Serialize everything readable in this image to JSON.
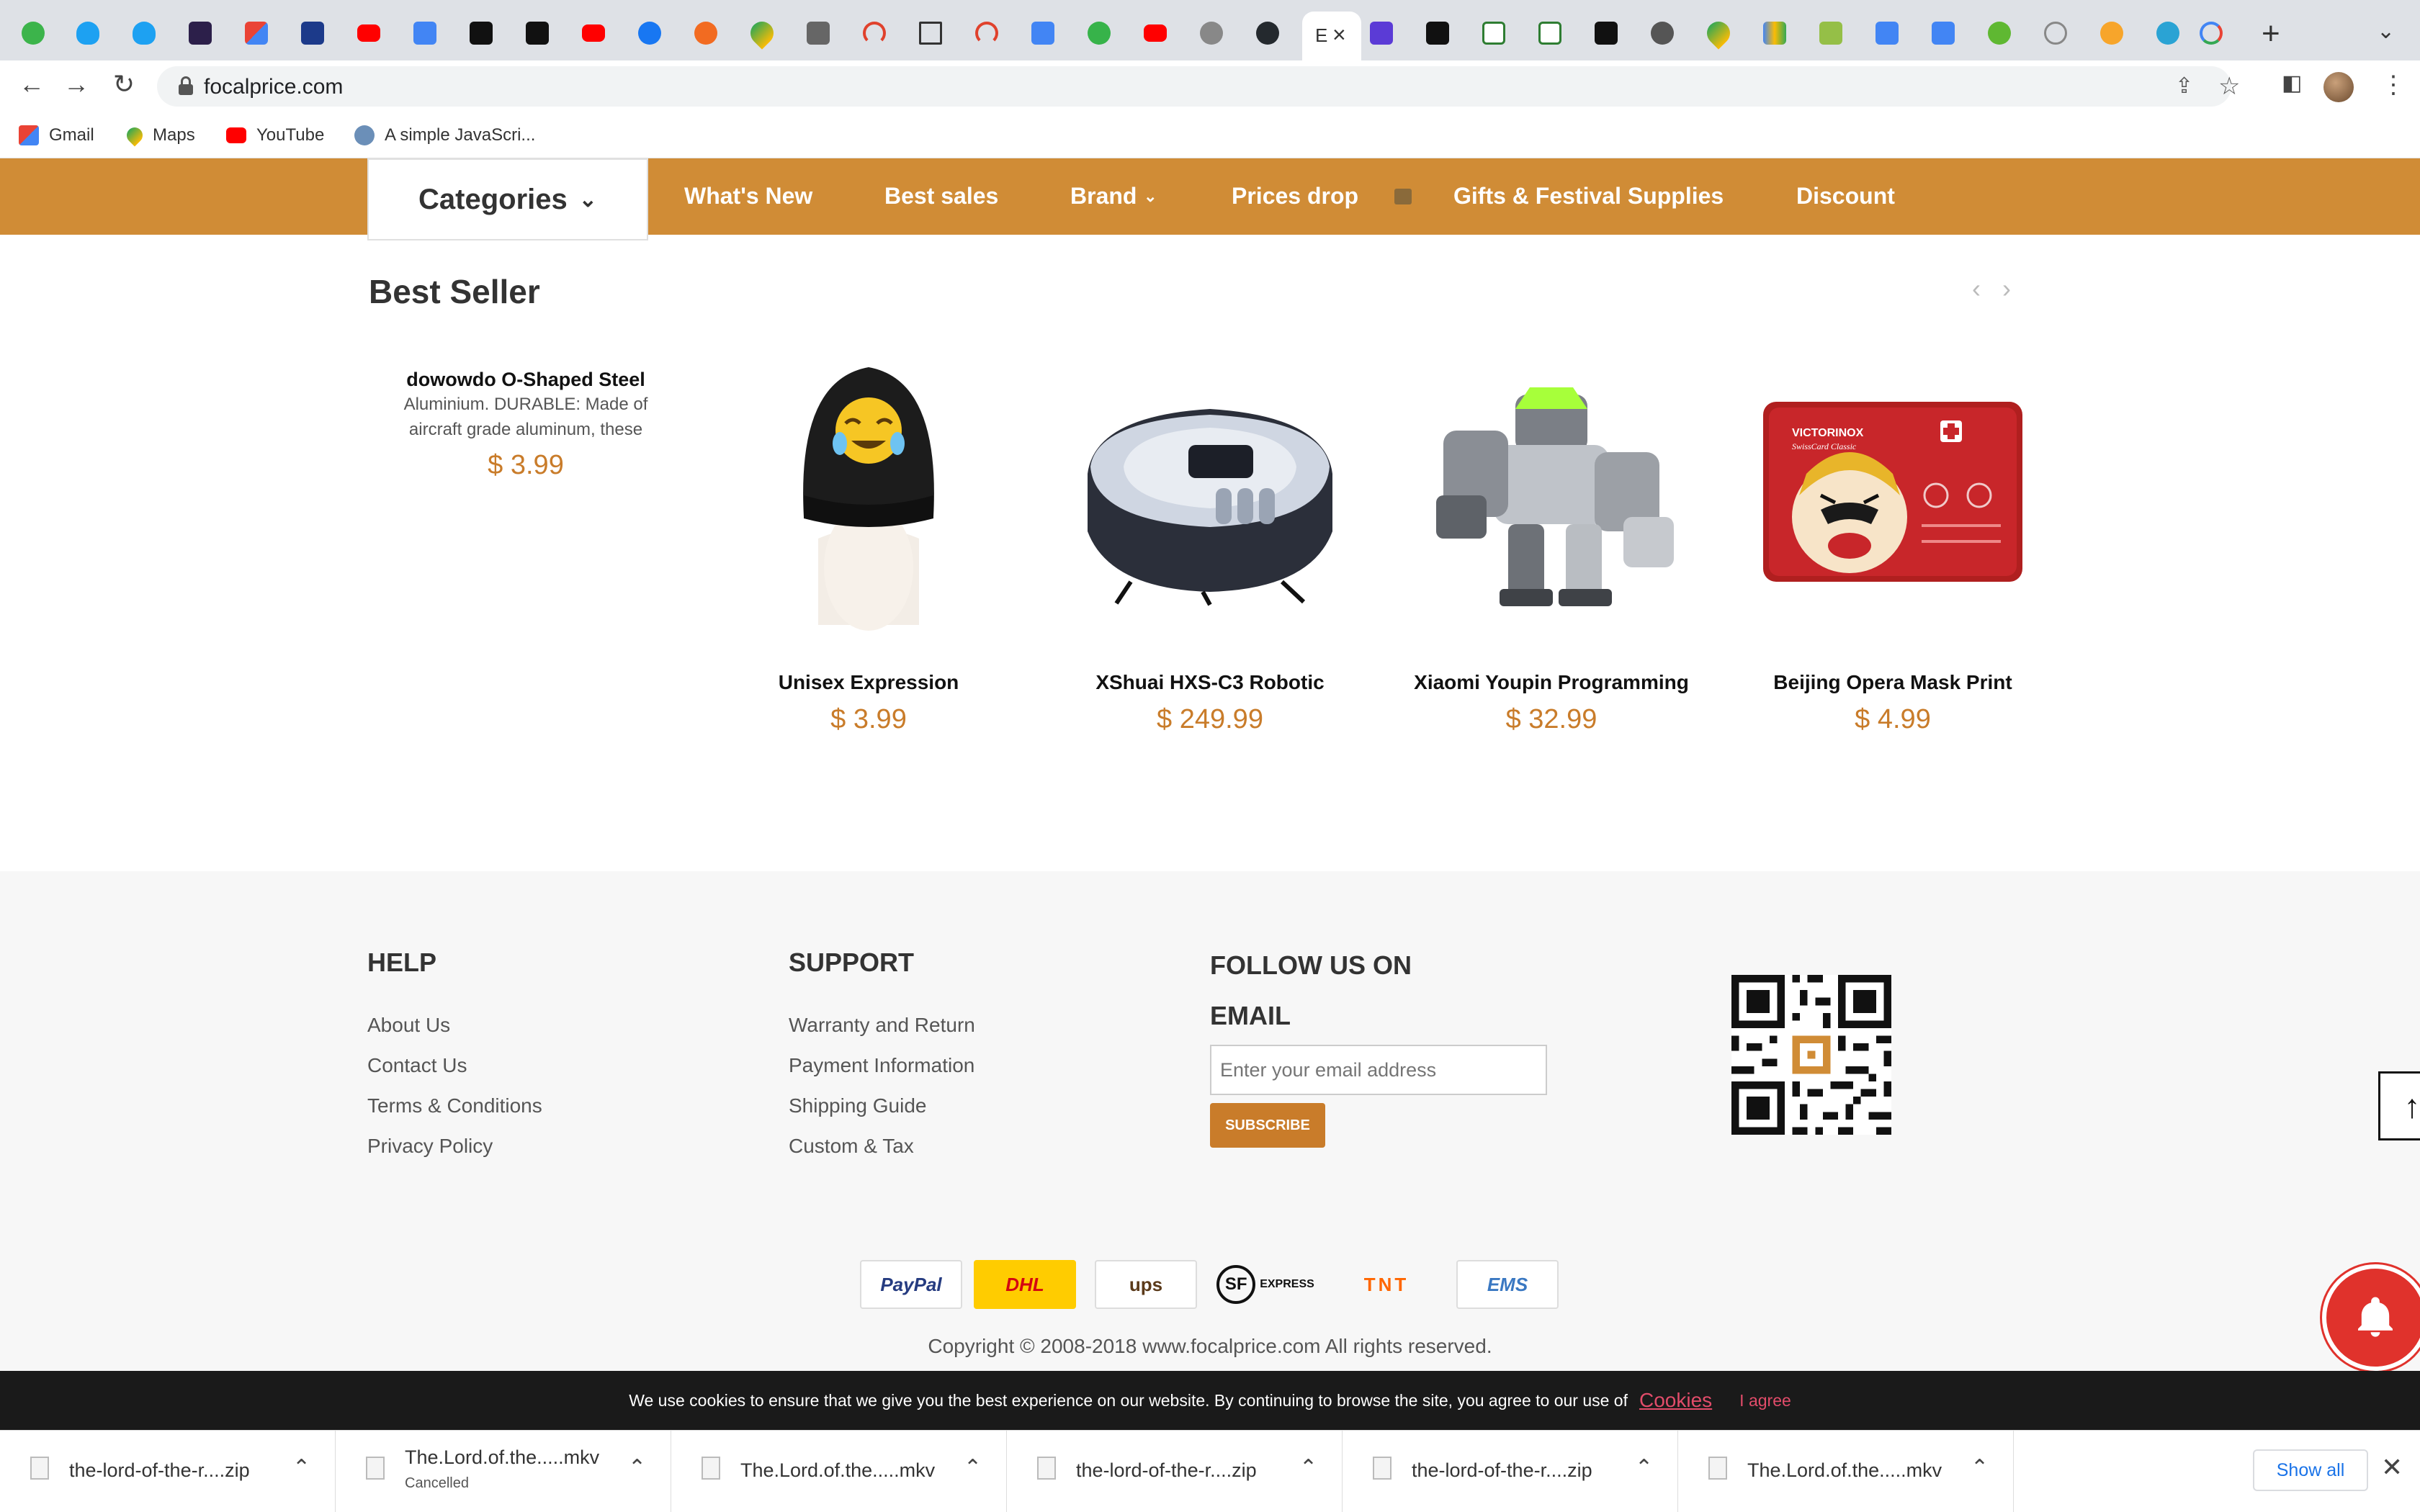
{
  "browser": {
    "active_tab_letter": "E",
    "tab_icon_names": [
      "spotify-icon",
      "twitter-icon",
      "twitter-icon",
      "fm-icon",
      "gmail-icon",
      "bank-icon",
      "youtube-icon",
      "docs-icon",
      "hn-icon",
      "hn-icon",
      "youtube-icon",
      "facebook-icon",
      "reddit-icon",
      "maps-icon",
      "photos-icon",
      "speedtest-icon",
      "square-icon",
      "speedtest-icon",
      "translate-icon",
      "green-icon",
      "youtube-icon",
      "globe-icon",
      "github-icon"
    ],
    "tab_icon_names_right": [
      "vp-icon",
      "hb-icon",
      "w-icon",
      "w-icon",
      "medium-icon",
      "globe-icon",
      "maps-icon",
      "shopping-icon",
      "shopify-icon",
      "translate-icon",
      "translate-icon",
      "v-icon",
      "video-icon",
      "star-icon",
      "t-icon",
      "google-icon"
    ],
    "url": "focalprice.com"
  },
  "bookmarks": [
    {
      "label": "Gmail",
      "icon": "gmail-icon"
    },
    {
      "label": "Maps",
      "icon": "maps-icon"
    },
    {
      "label": "YouTube",
      "icon": "youtube-icon"
    },
    {
      "label": "A simple JavaScri...",
      "icon": "globe-icon"
    }
  ],
  "nav": {
    "categories": "Categories",
    "links": [
      "What's New",
      "Best sales",
      "Brand",
      "Prices drop",
      "Gifts & Festival Supplies",
      "Discount"
    ]
  },
  "best_seller": {
    "title": "Best Seller",
    "first": {
      "name": "dowowdo O-Shaped Steel",
      "desc1": "Aluminium. DURABLE: Made of",
      "desc2": "aircraft grade aluminum, these",
      "price": "$ 3.99"
    },
    "products": [
      {
        "name": "Unisex Expression",
        "price": "$ 3.99"
      },
      {
        "name": "XShuai HXS-C3 Robotic",
        "price": "$ 249.99"
      },
      {
        "name": "Xiaomi Youpin Programming",
        "price": "$ 32.99"
      },
      {
        "name": "Beijing Opera Mask Print",
        "price": "$ 4.99"
      }
    ]
  },
  "footer": {
    "help": {
      "title": "HELP",
      "links": [
        "About Us",
        "Contact Us",
        "Terms & Conditions",
        "Privacy Policy"
      ]
    },
    "support": {
      "title": "SUPPORT",
      "links": [
        "Warranty and Return",
        "Payment Information",
        "Shipping Guide",
        "Custom & Tax"
      ]
    },
    "follow": {
      "title": "FOLLOW US ON",
      "email_title": "EMAIL",
      "placeholder": "Enter your email address",
      "subscribe": "SUBSCRIBE"
    },
    "payments": [
      "PayPal",
      "DHL",
      "ups",
      "EXPRESS",
      "TNT",
      "EMS"
    ],
    "copyright": "Copyright © 2008-2018 www.focalprice.com All rights reserved."
  },
  "cookie": {
    "text": "We use cookies to ensure that we give you the best experience on our website. By continuing to browse the site, you agree to our use of",
    "link": "Cookies",
    "agree": "I agree"
  },
  "downloads": {
    "items": [
      {
        "name": "the-lord-of-the-r....zip",
        "status": ""
      },
      {
        "name": "The.Lord.of.the.....mkv",
        "status": "Cancelled"
      },
      {
        "name": "The.Lord.of.the.....mkv",
        "status": ""
      },
      {
        "name": "the-lord-of-the-r....zip",
        "status": ""
      },
      {
        "name": "the-lord-of-the-r....zip",
        "status": ""
      },
      {
        "name": "The.Lord.of.the.....mkv",
        "status": ""
      }
    ],
    "show_all": "Show all"
  },
  "colors": {
    "accent": "#d08c36",
    "price": "#c97c2a",
    "cookie_link": "#e24c6a"
  }
}
